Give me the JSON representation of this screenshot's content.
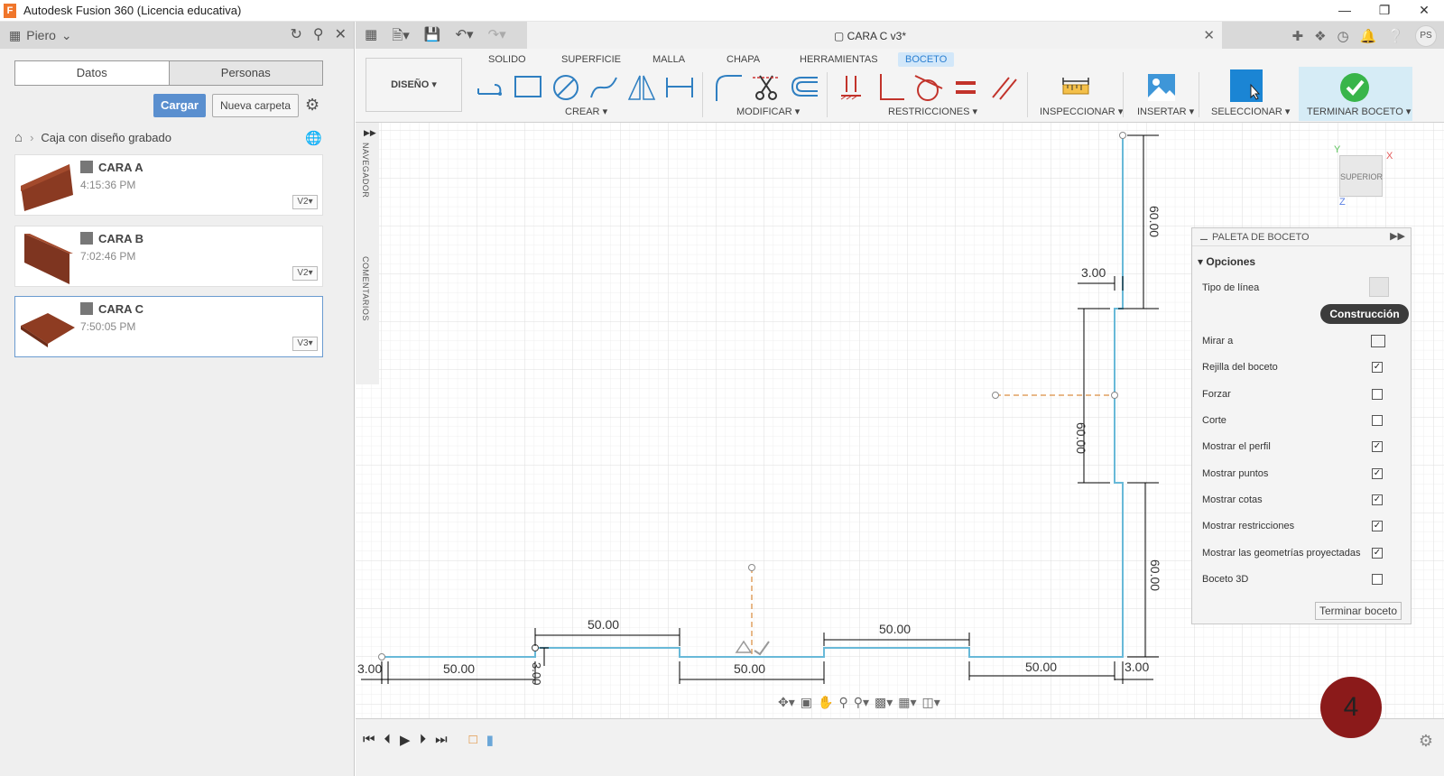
{
  "app": {
    "title": "Autodesk Fusion 360 (Licencia educativa)"
  },
  "window": {
    "min": "—",
    "max": "❐",
    "close": "✕"
  },
  "leftpanel": {
    "user": "Piero",
    "tabs": [
      {
        "label": "Datos"
      },
      {
        "label": "Personas"
      }
    ],
    "cargar": "Cargar",
    "nueva_carpeta": "Nueva carpeta",
    "breadcrumb": "Caja con diseño grabado",
    "files": [
      {
        "name": "CARA A",
        "time": "4:15:36 PM",
        "version": "V2"
      },
      {
        "name": "CARA B",
        "time": "7:02:46 PM",
        "version": "V2"
      },
      {
        "name": "CARA C",
        "time": "7:50:05 PM",
        "version": "V3"
      }
    ]
  },
  "document": {
    "tab_name": "CARA C v3*",
    "avatar": "PS"
  },
  "ribbon": {
    "workspace": "DISEÑO",
    "tabs": [
      "SOLIDO",
      "SUPERFICIE",
      "MALLA",
      "CHAPA",
      "HERRAMIENTAS",
      "BOCETO"
    ],
    "active_tab": "BOCETO",
    "groups": {
      "crear": "CREAR",
      "modificar": "MODIFICAR",
      "restricciones": "RESTRICCIONES",
      "inspeccionar": "INSPECCIONAR",
      "insertar": "INSERTAR",
      "seleccionar": "SELECCIONAR",
      "terminar": "TERMINAR BOCETO"
    },
    "dropdown_arrow": "▾"
  },
  "navigator": {
    "navegador": "NAVEGADOR",
    "comentarios": "COMENTARIOS"
  },
  "viewcube": {
    "face": "SUPERIOR",
    "x": "X",
    "y": "Y",
    "z": "Z"
  },
  "sketch": {
    "dims": {
      "left_3": "3.00",
      "bottom_50_1": "50.00",
      "top_50_1": "50.00",
      "vert_3": "3.00",
      "bottom_50_2": "50.00",
      "top_50_2": "50.00",
      "bottom_50_3": "50.00",
      "right_3": "3.00",
      "right_60_top": "60.00",
      "right_3_top": "3.00",
      "mid_60": "60.00",
      "right_60_bottom": "60.00"
    },
    "colors": {
      "profile": "#68b9d8",
      "construction": "#e0a060",
      "dim": "#000000"
    }
  },
  "palette": {
    "title": "PALETA DE BOCETO",
    "section": "Opciones",
    "tipo_linea": "Tipo de línea",
    "construccion": "Construcción",
    "mirar_a": "Mirar a",
    "options": [
      {
        "label": "Rejilla del boceto",
        "checked": true
      },
      {
        "label": "Forzar",
        "checked": false
      },
      {
        "label": "Corte",
        "checked": false
      },
      {
        "label": "Mostrar el perfil",
        "checked": true
      },
      {
        "label": "Mostrar puntos",
        "checked": true
      },
      {
        "label": "Mostrar cotas",
        "checked": true
      },
      {
        "label": "Mostrar restricciones",
        "checked": true
      },
      {
        "label": "Mostrar las geometrías proyectadas",
        "checked": true
      },
      {
        "label": "Boceto 3D",
        "checked": false
      }
    ],
    "terminar": "Terminar boceto"
  },
  "badge": "4"
}
